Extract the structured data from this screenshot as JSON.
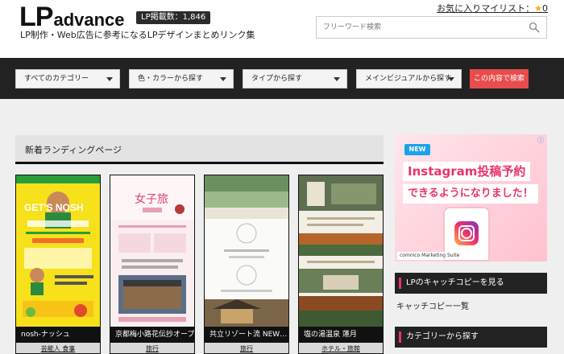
{
  "header": {
    "logo_lp": "LP",
    "logo_advance": "advance",
    "lp_count": "LP掲載数：1,846",
    "tagline": "LP制作・Web広告に参考になるLPデザインまとめリンク集",
    "favorites_label": "お気に入りマイリスト：",
    "favorites_star": "★",
    "favorites_count": "0",
    "search_placeholder": "フリーワード検索"
  },
  "filters": {
    "category": "すべてのカテゴリー",
    "color": "色・カラーから探す",
    "type": "タイプから探す",
    "main_visual": "メインビジュアルから探す",
    "search_button": "この内容で検索"
  },
  "main": {
    "section_title": "新着ランディングページ",
    "cards": [
      {
        "title": "nosh-ナッシュ",
        "tag": "芸能人 食事"
      },
      {
        "title": "京都梅小路花伝抄オープ…",
        "tag": "旅行"
      },
      {
        "title": "共立リゾート流 NEW…",
        "tag": "旅行"
      },
      {
        "title": "塩の湯温泉 蓮月",
        "tag": "ホテル・旅館"
      }
    ]
  },
  "sidebar": {
    "ad": {
      "badge": "NEW",
      "line1": "Instagram投稿予約",
      "line2": "できるようになりました！",
      "brand": "comnico Marketing Suite"
    },
    "catchcopy_head": "LPのキャッチコピーを見る",
    "catchcopy_link": "キャッチコピー一覧",
    "category_head": "カテゴリーから探す"
  },
  "colors": {
    "accent": "#e94c4c",
    "dark_bar": "#222222",
    "ad_pink": "#e9336a"
  }
}
